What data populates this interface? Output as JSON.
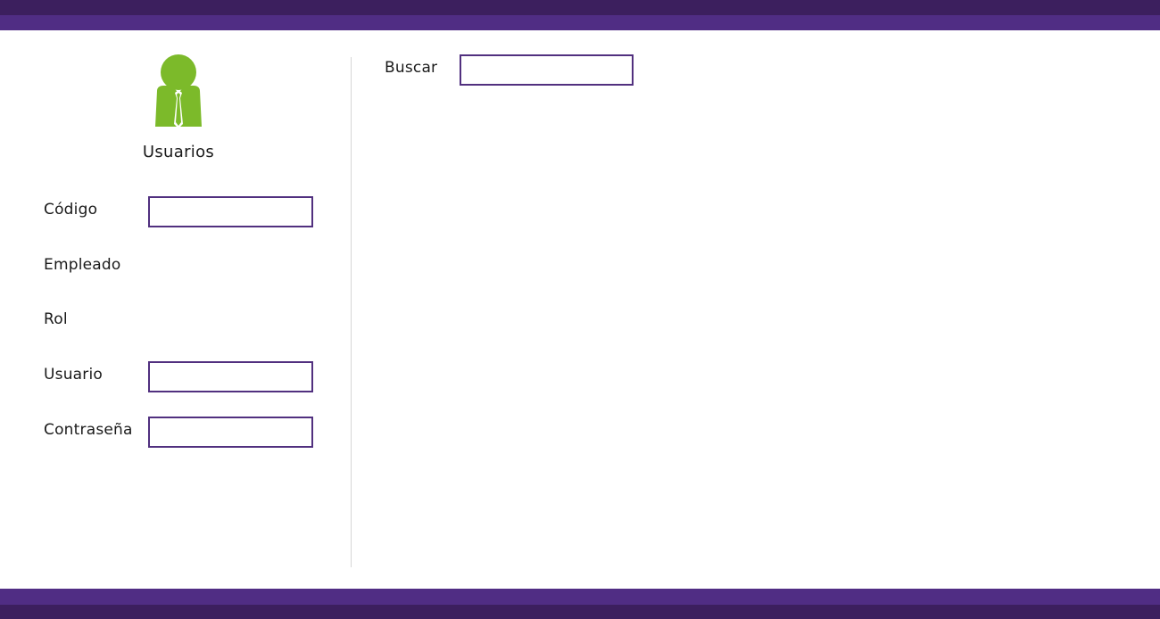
{
  "colors": {
    "header_dark": "#3c1f5e",
    "header_light": "#502d84",
    "input_border": "#51307f",
    "icon_green": "#7cba2a",
    "divider": "#d6d6d6"
  },
  "panel": {
    "icon": "user-tie-icon",
    "title": "Usuarios",
    "fields": {
      "codigo": {
        "label": "Código",
        "value": ""
      },
      "empleado": {
        "label": "Empleado"
      },
      "rol": {
        "label": "Rol"
      },
      "usuario": {
        "label": "Usuario",
        "value": ""
      },
      "contrasena": {
        "label": "Contraseña",
        "value": ""
      }
    }
  },
  "search": {
    "label": "Buscar",
    "value": ""
  }
}
